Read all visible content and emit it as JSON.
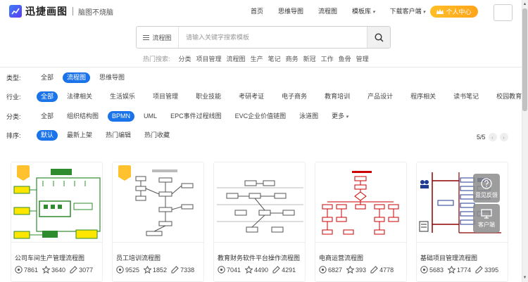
{
  "header": {
    "logo_text": "迅捷画图",
    "slogan": "脑图不烧脑",
    "nav": [
      "首页",
      "思维导图",
      "流程图",
      "模板库",
      "下载客户端"
    ],
    "user_center": "个人中心"
  },
  "search": {
    "type": "流程图",
    "placeholder": "请输入关键字搜索模板",
    "hot_label": "热门搜索:",
    "hot_terms": [
      "分类",
      "项目管理",
      "流程图",
      "生产",
      "笔记",
      "商务",
      "新冠",
      "工作",
      "鱼骨",
      "管理"
    ]
  },
  "filters": {
    "type": {
      "label": "类型:",
      "options": [
        "全部",
        "流程图",
        "思维导图"
      ],
      "selected": 1
    },
    "industry": {
      "label": "行业:",
      "options": [
        "全部",
        "法律相关",
        "生活娱乐",
        "项目管理",
        "职业技能",
        "考研考证",
        "电子商务",
        "教育培训",
        "产品设计",
        "程序相关",
        "读书笔记",
        "校园教育"
      ],
      "selected": 0
    },
    "category": {
      "label": "分类:",
      "options": [
        "全部",
        "组织结构图",
        "BPMN",
        "UML",
        "EPC事件过程线图",
        "EVC企业价值链图",
        "泳道图",
        "更多"
      ],
      "selected": 2
    },
    "sort": {
      "label": "排序:",
      "options": [
        "默认",
        "最新上架",
        "热门编辑",
        "热门收藏"
      ],
      "selected": 0
    }
  },
  "pager": {
    "text": "5/5"
  },
  "cards": [
    {
      "title": "公司车间生产管理流程图",
      "views": "7861",
      "stars": "3640",
      "edits": "3077",
      "badge": true
    },
    {
      "title": "员工培训流程图",
      "views": "9525",
      "stars": "1852",
      "edits": "7338",
      "badge": true
    },
    {
      "title": "教育财务软件平台操作流程图",
      "views": "7041",
      "stars": "4490",
      "edits": "4291",
      "badge": false
    },
    {
      "title": "电商运营流程图",
      "views": "6827",
      "stars": "393",
      "edits": "4778",
      "badge": false
    },
    {
      "title": "基础项目管理流程图",
      "views": "5683",
      "stars": "1774",
      "edits": "3395",
      "badge": false
    }
  ],
  "side": {
    "feedback": "意见反馈",
    "service": "客户端"
  },
  "colors": {
    "accent": "#1a73e8",
    "gold": "#ffb21f",
    "green": "#2e8b2e"
  }
}
